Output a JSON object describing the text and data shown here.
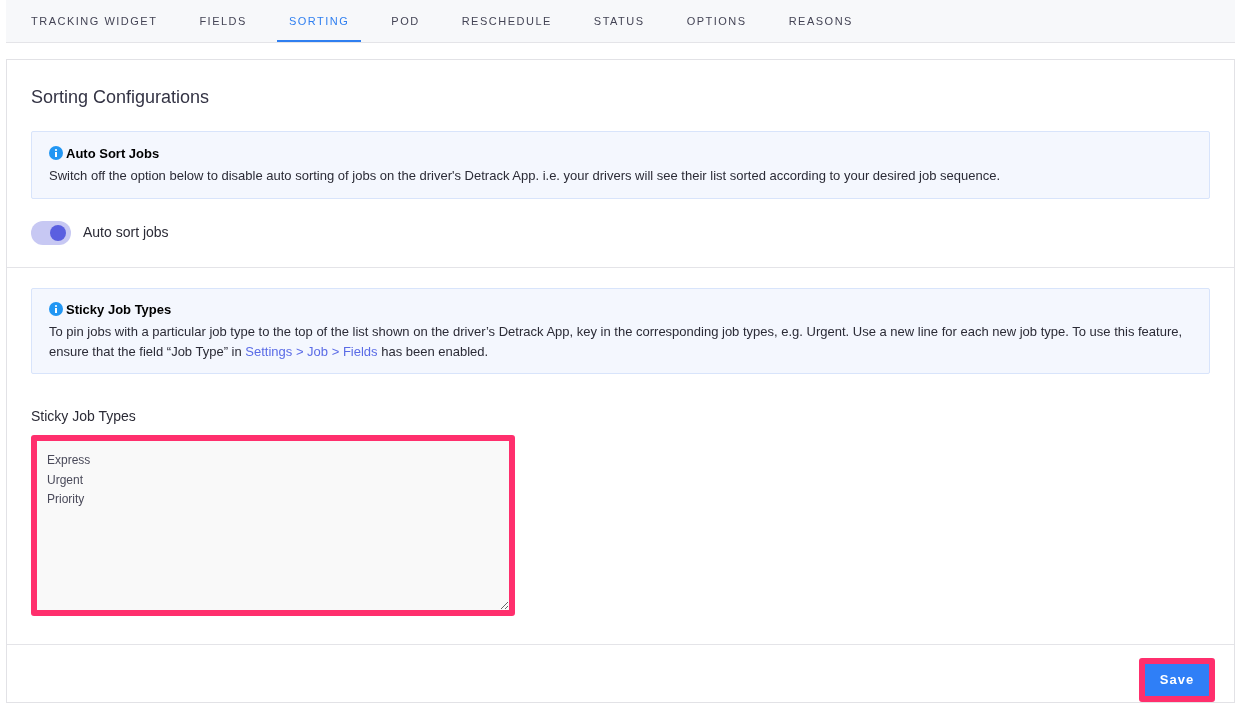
{
  "tabs": [
    {
      "label": "TRACKING WIDGET",
      "selected": false
    },
    {
      "label": "FIELDS",
      "selected": false
    },
    {
      "label": "SORTING",
      "selected": true
    },
    {
      "label": "POD",
      "selected": false
    },
    {
      "label": "RESCHEDULE",
      "selected": false
    },
    {
      "label": "STATUS",
      "selected": false
    },
    {
      "label": "OPTIONS",
      "selected": false
    },
    {
      "label": "REASONS",
      "selected": false
    }
  ],
  "title": "Sorting Configurations",
  "auto_sort_info": {
    "title": "Auto Sort Jobs",
    "text": "Switch off the option below to disable auto sorting of jobs on the driver's Detrack App. i.e. your drivers will see their list sorted according to your desired job sequence."
  },
  "auto_sort_toggle": {
    "label": "Auto sort jobs",
    "on": true
  },
  "sticky_info": {
    "title": "Sticky Job Types",
    "text_before": "To pin jobs with a particular job type to the top of the list shown on the driver’s Detrack App, key in the corresponding job types, e.g. Urgent. Use a new line for each new job type. To use this feature, ensure that the field “Job Type” in ",
    "link": "Settings > Job > Fields",
    "text_after": " has been enabled."
  },
  "sticky_field": {
    "label": "Sticky Job Types",
    "value": "Express\nUrgent\nPriority",
    "highlighted": true
  },
  "save_button": {
    "label": "Save",
    "highlighted": true
  }
}
